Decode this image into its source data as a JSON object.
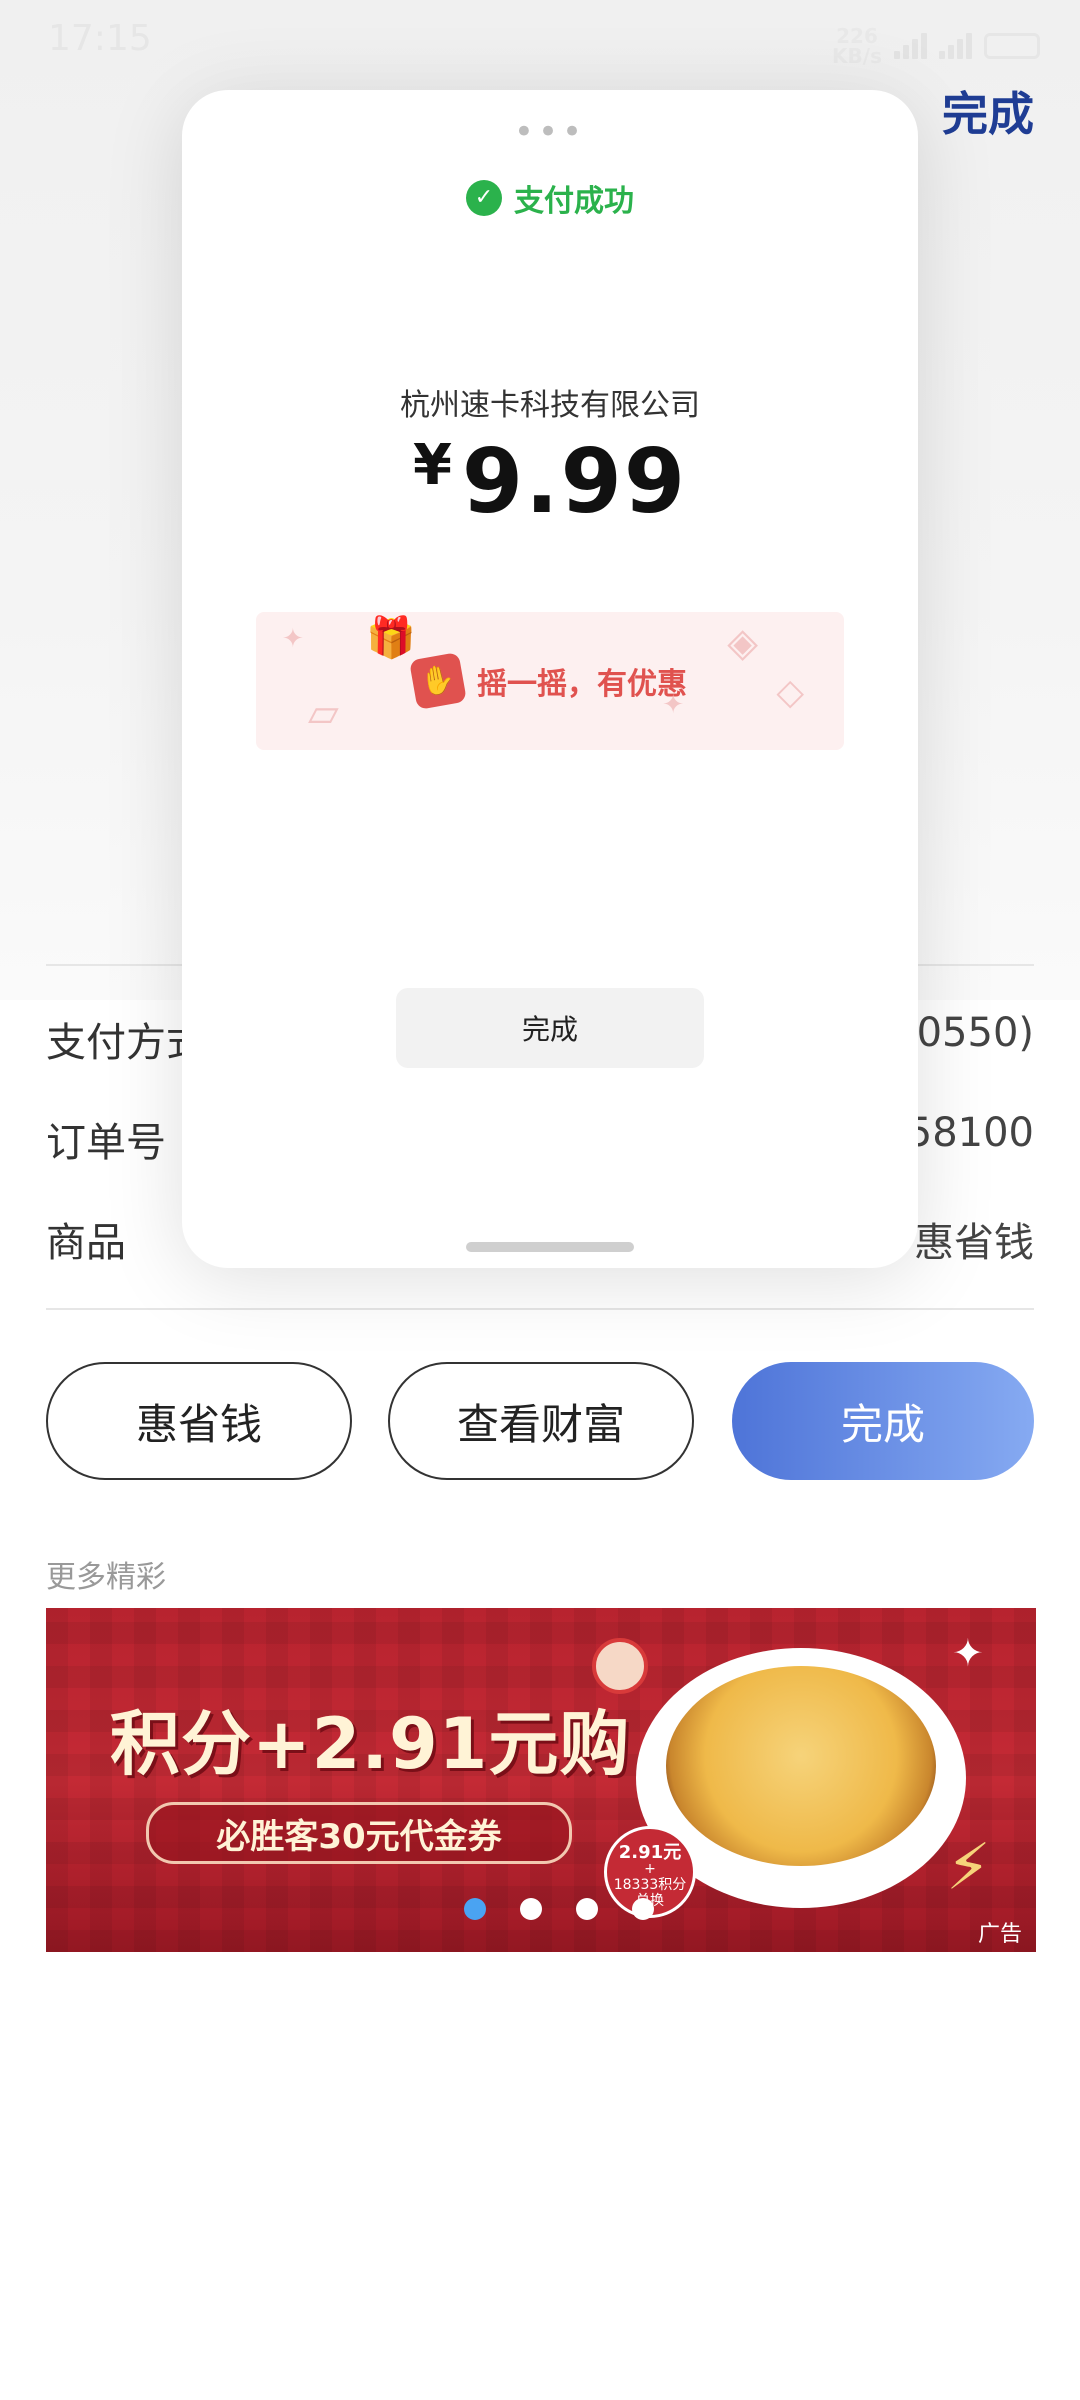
{
  "status_bar": {
    "time": "17:15",
    "speed_value": "226",
    "speed_unit": "KB/s"
  },
  "header": {
    "done_label": "完成"
  },
  "order_info": [
    {
      "label": "支付方式",
      "value": "(0550)"
    },
    {
      "label": "订单号",
      "value": "58100"
    },
    {
      "label": "商品",
      "value": "惠省钱"
    }
  ],
  "actions": {
    "save_money_label": "惠省钱",
    "wealth_label": "查看财富",
    "done_label": "完成"
  },
  "more": {
    "title": "更多精彩",
    "banner": {
      "headline": "积分+2.91元购",
      "coupon_text": "必胜客30元代金券",
      "badge_price": "2.91元",
      "badge_plus": "+",
      "badge_points": "18333积分",
      "badge_action": "兑换",
      "ad_label": "广告",
      "active_dot": 0,
      "dot_count": 4
    }
  },
  "payment_sheet": {
    "status_text": "支付成功",
    "merchant": "杭州速卡科技有限公司",
    "currency": "¥",
    "amount": "9.99",
    "promo_text": "摇一摇，有优惠",
    "done_label": "完成"
  },
  "colors": {
    "wechat_green": "#2bb24c",
    "promo_red": "#e0524f",
    "primary_blue": "#4e74d8",
    "link_blue": "#1f3d94"
  }
}
